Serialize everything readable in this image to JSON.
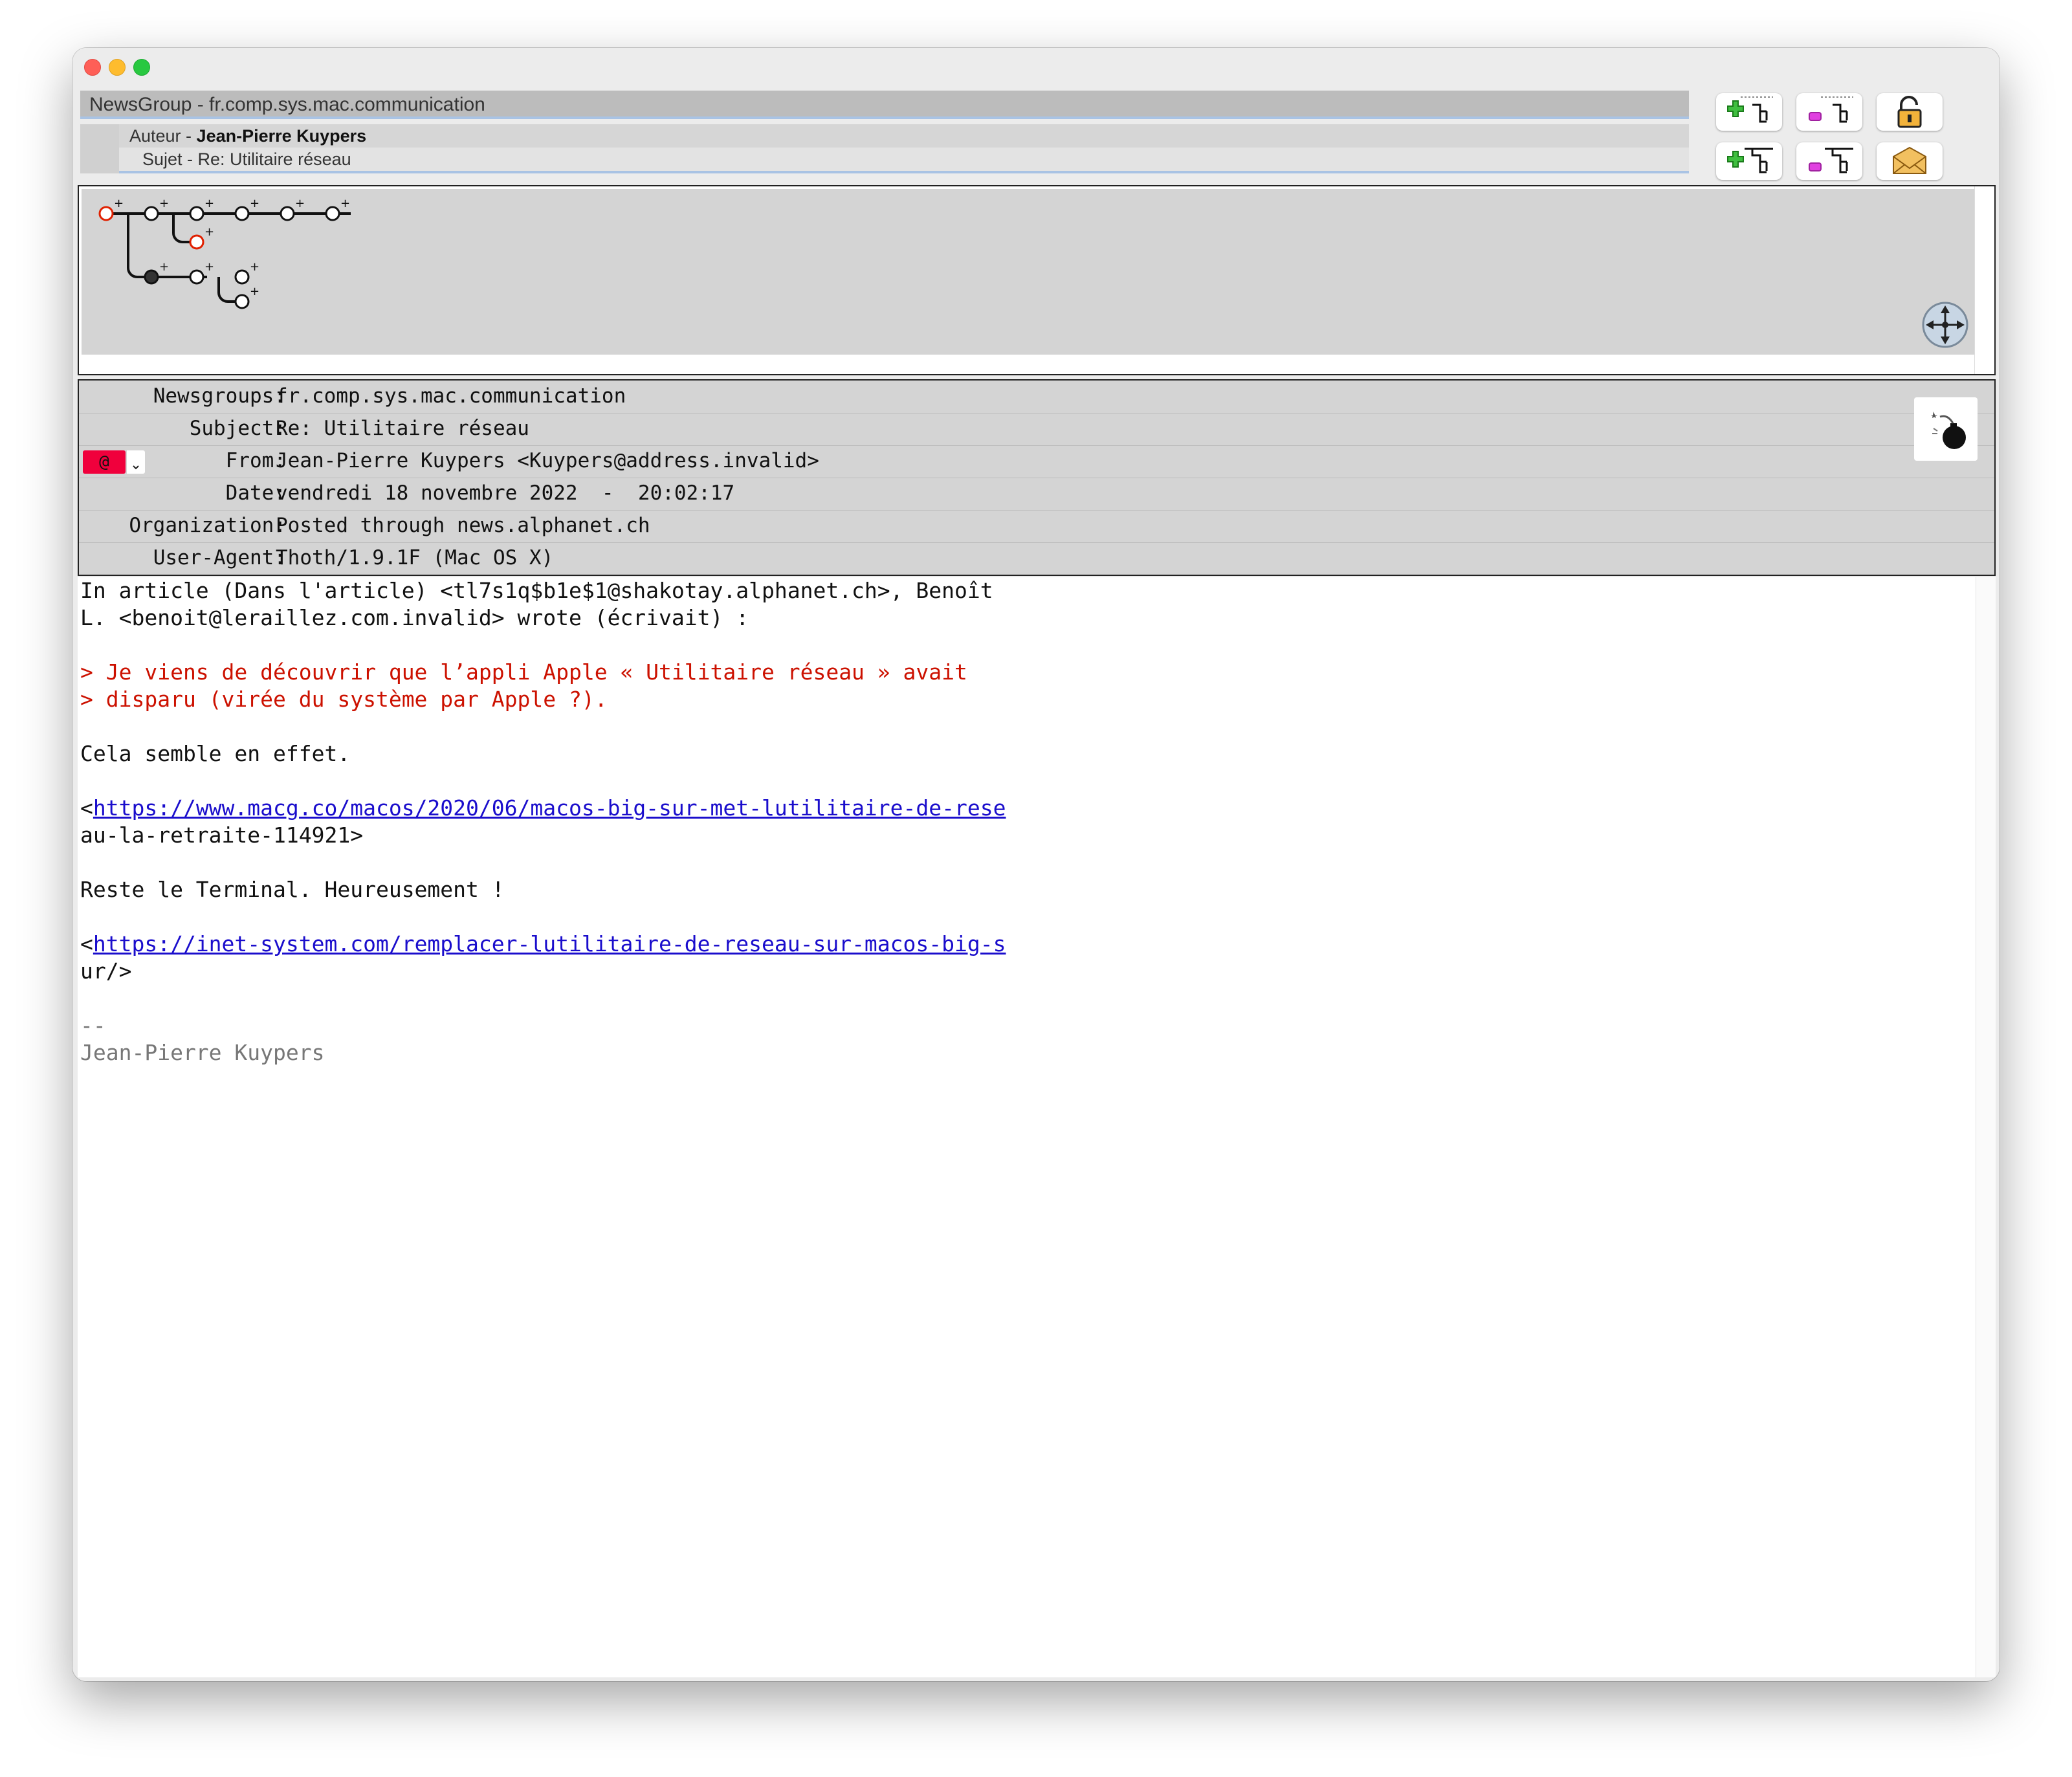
{
  "header": {
    "newsgroup_label": "NewsGroup - fr.comp.sys.mac.communication",
    "author_prefix": "Auteur - ",
    "author_name": "Jean-Pierre Kuypers",
    "subject_line": "Sujet - Re: Utilitaire réseau",
    "help_label": "?"
  },
  "toolbar": {
    "icons": [
      "add-thread-icon",
      "mark-thread-icon",
      "lock-icon",
      "add-subthread-icon",
      "mark-subthread-icon",
      "envelope-icon",
      "gear-icon",
      "help-icon"
    ]
  },
  "thread_tree": {
    "icons": [
      "thread-tree-icon",
      "navigation-compass-icon"
    ]
  },
  "headers": {
    "newsgroups_label": "Newsgroups:",
    "newsgroups_value": "fr.comp.sys.mac.communication",
    "subject_label": "Subject:",
    "subject_value": "Re: Utilitaire réseau",
    "from_label": "From:",
    "from_value": "Jean-Pierre Kuypers <Kuypers@address.invalid>",
    "from_badge": "@",
    "date_label": "Date:",
    "date_value": "vendredi 18 novembre 2022  -  20:02:17",
    "organization_label": "Organization:",
    "organization_value": "Posted through news.alphanet.ch",
    "useragent_label": "User-Agent:",
    "useragent_value": "Thoth/1.9.1F (Mac OS X)"
  },
  "body": {
    "line1": "In article (Dans l'article) <tl7s1q$b1e$1@shakotay.alphanet.ch>, Benoît",
    "line2": "L. <benoit@leraillez.com.invalid> wrote (écrivait) :",
    "quote1": "> Je viens de découvrir que l’appli Apple « Utilitaire réseau » avait",
    "quote2": "> disparu (virée du système par Apple ?).",
    "line3": "Cela semble en effet.",
    "link1_open": "<",
    "link1_url": "https://www.macg.co/macos/2020/06/macos-big-sur-met-lutilitaire-de-rese",
    "link1_tail": "au-la-retraite-114921>",
    "line4": "Reste le Terminal. Heureusement !",
    "link2_open": "<",
    "link2_url": "https://inet-system.com/remplacer-lutilitaire-de-reseau-sur-macos-big-s",
    "link2_tail": "ur/>",
    "sig_sep": "--",
    "sig_name": "Jean-Pierre Kuypers"
  }
}
